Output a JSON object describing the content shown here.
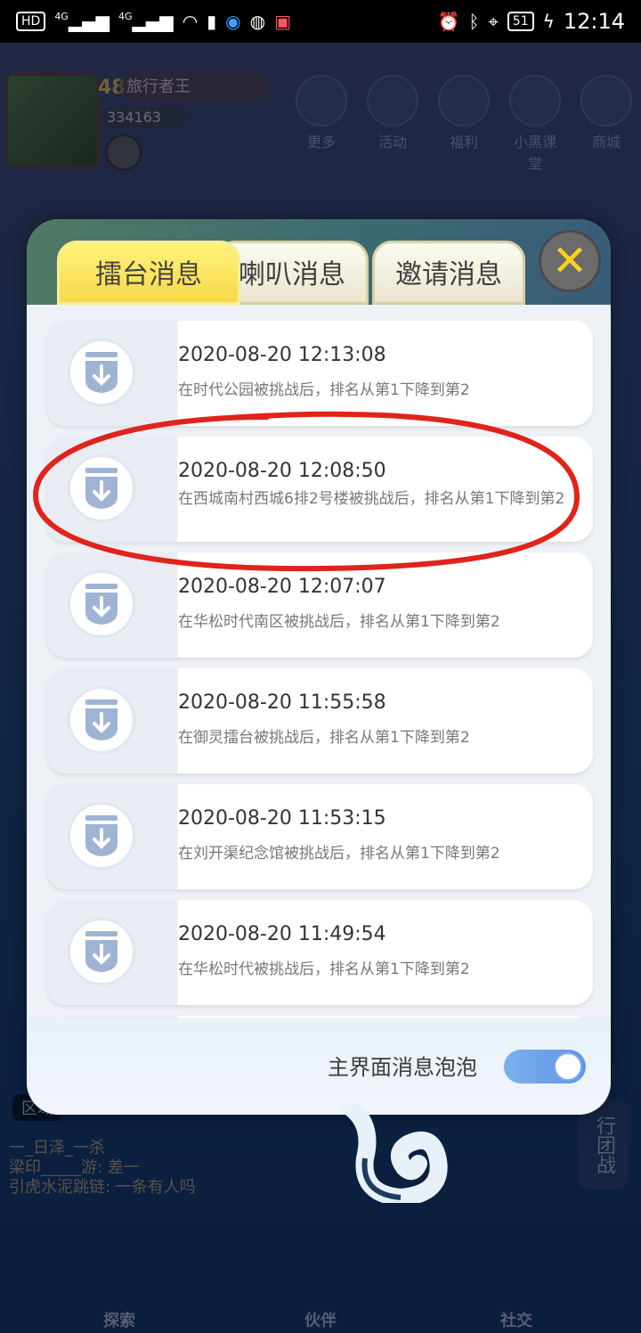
{
  "status_bar": {
    "left_badges": [
      "HD",
      "4G",
      "4G"
    ],
    "battery_level": "51",
    "time": "12:14"
  },
  "game": {
    "player": {
      "level": "48",
      "name": "旅行者王",
      "coins": "334163"
    },
    "top_menu": [
      {
        "label": "更多"
      },
      {
        "label": "活动"
      },
      {
        "label": "福利"
      },
      {
        "label": "小黑课堂"
      },
      {
        "label": "商城"
      }
    ],
    "chat": {
      "area_chip": "区域",
      "lines": [
        "一_日泽_一杀",
        "梁印_____游: 差一",
        "引虎水泥跳链: 一条有人吗"
      ]
    },
    "side_button": "行团战",
    "bottom_nav": [
      {
        "label": "探索"
      },
      {
        "label": "伙伴"
      },
      {
        "label": "社交"
      }
    ]
  },
  "dialog": {
    "tabs": [
      {
        "label": "擂台消息",
        "active": true
      },
      {
        "label": "喇叭消息",
        "active": false
      },
      {
        "label": "邀请消息",
        "active": false
      }
    ],
    "messages": [
      {
        "time": "2020-08-20 12:13:08",
        "text": "在时代公园被挑战后，排名从第1下降到第2",
        "icon": "rank-down-icon"
      },
      {
        "time": "2020-08-20 12:08:50",
        "text": "在西城南村西城6排2号楼被挑战后，排名从第1下降到第2",
        "icon": "rank-down-icon",
        "circled": true
      },
      {
        "time": "2020-08-20 12:07:07",
        "text": "在华松时代南区被挑战后，排名从第1下降到第2",
        "icon": "rank-down-icon"
      },
      {
        "time": "2020-08-20 11:55:58",
        "text": "在御灵擂台被挑战后，排名从第1下降到第2",
        "icon": "rank-down-icon"
      },
      {
        "time": "2020-08-20 11:53:15",
        "text": "在刘开渠纪念馆被挑战后，排名从第1下降到第2",
        "icon": "rank-down-icon"
      },
      {
        "time": "2020-08-20 11:49:54",
        "text": "在华松时代被挑战后，排名从第1下降到第2",
        "icon": "rank-down-icon"
      }
    ],
    "footer": {
      "toggle_label": "主界面消息泡泡",
      "toggle_on": true
    }
  },
  "colors": {
    "annotation": "#e0231b",
    "tab_active": "#f7d84a",
    "toggle": "#5f95e6",
    "icon": "#9fb3d4"
  }
}
